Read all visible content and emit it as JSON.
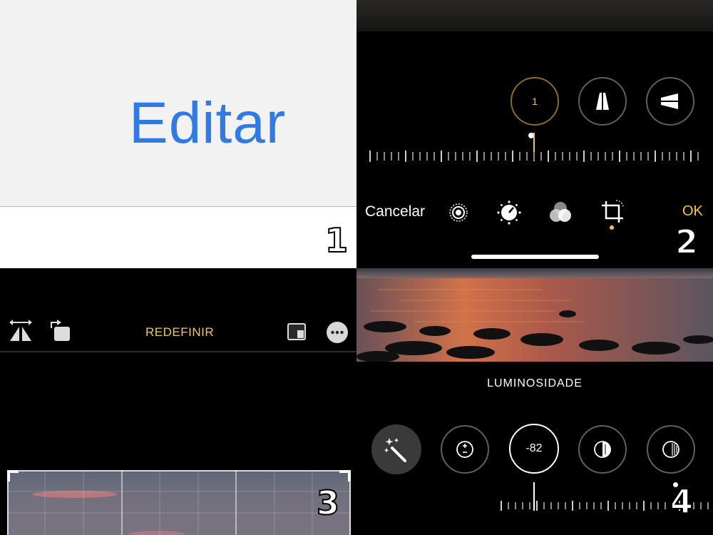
{
  "panel1": {
    "edit_label": "Editar",
    "step_number": "1"
  },
  "panel2": {
    "straighten_value": "1",
    "cancel_label": "Cancelar",
    "ok_label": "OK",
    "step_number": "2",
    "accent_color": "#f5c542",
    "tool_icons": [
      "live-icon",
      "adjust-dial-icon",
      "filters-icon",
      "crop-rotate-icon"
    ]
  },
  "panel3": {
    "reset_label": "REDEFINIR",
    "step_number": "3",
    "accent_color": "#f0c75e"
  },
  "panel4": {
    "adjustment_label": "LUMINOSIDADE",
    "value": "-82",
    "step_number": "4",
    "tool_icons": [
      "auto-enhance-icon",
      "exposure-icon",
      "brilliance-icon",
      "highlights-icon",
      "shadows-icon"
    ]
  },
  "colors": {
    "link_blue": "#2f7ae5",
    "accent_yellow": "#f5c542"
  }
}
